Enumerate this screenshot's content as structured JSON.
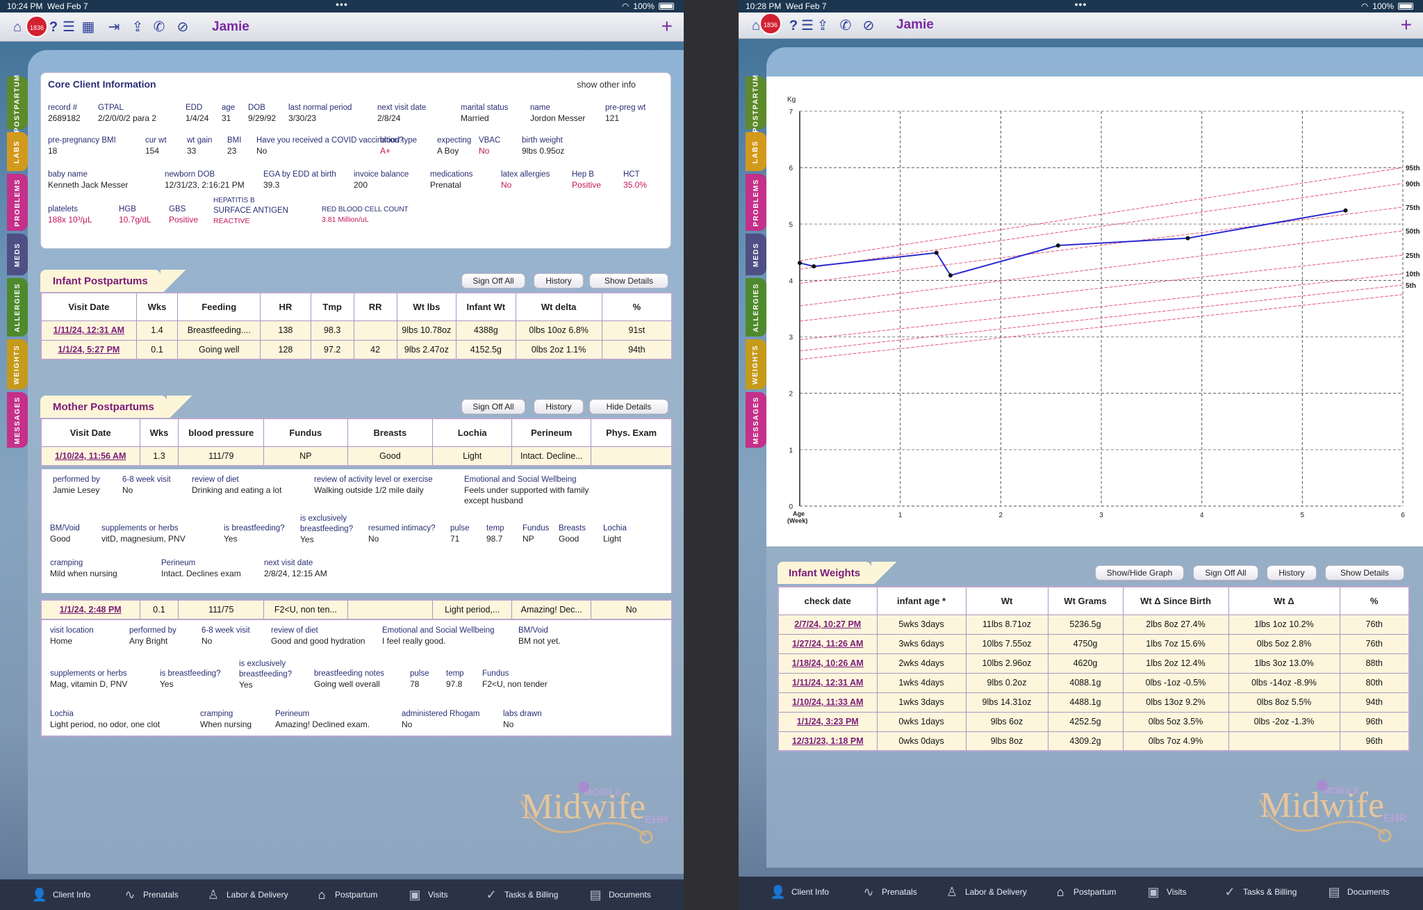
{
  "left": {
    "status": {
      "time": "10:24 PM",
      "date": "Wed Feb 7",
      "battery": "100%"
    },
    "topbar": {
      "badge": "1836",
      "patient": "Jamie"
    },
    "sidetabs": [
      "POSTPARTUM",
      "LABS",
      "PROBLEMS",
      "MEDS",
      "ALLERGIES",
      "WEIGHTS",
      "MESSAGES"
    ],
    "core": {
      "title": "Core Client Information",
      "other": "show other info",
      "fields": [
        {
          "l": "record #",
          "v": "2689182"
        },
        {
          "l": "GTPAL",
          "v": "2/2/0/0/2 para 2"
        },
        {
          "l": "EDD",
          "v": "1/4/24"
        },
        {
          "l": "age",
          "v": "31"
        },
        {
          "l": "DOB",
          "v": "9/29/92"
        },
        {
          "l": "last normal period",
          "v": "3/30/23"
        },
        {
          "l": "next visit date",
          "v": "2/8/24"
        },
        {
          "l": "marital status",
          "v": "Married"
        },
        {
          "l": "name",
          "v": "Jordon Messer"
        },
        {
          "l": "pre-preg wt",
          "v": "121"
        },
        {
          "l": "pre-pregnancy BMI",
          "v": "18"
        },
        {
          "l": "cur wt",
          "v": "154"
        },
        {
          "l": "wt gain",
          "v": "33"
        },
        {
          "l": "BMI",
          "v": "23"
        },
        {
          "l": "Have you received a COVID vaccination?",
          "v": "No"
        },
        {
          "l": "blood type",
          "v": "A+"
        },
        {
          "l": "expecting",
          "v": "A Boy"
        },
        {
          "l": "VBAC",
          "v": "No"
        },
        {
          "l": "birth weight",
          "v": "9lbs 0.95oz"
        },
        {
          "l": "baby name",
          "v": "Kenneth Jack Messer"
        },
        {
          "l": "newborn DOB",
          "v": "12/31/23, 2:16:21 PM"
        },
        {
          "l": "EGA by EDD at birth",
          "v": "39.3"
        },
        {
          "l": "invoice balance",
          "v": "200"
        },
        {
          "l": "medications",
          "v": "Prenatal"
        },
        {
          "l": "latex allergies",
          "v": "No"
        },
        {
          "l": "Hep B",
          "v": "Positive"
        },
        {
          "l": "HCT",
          "v": "35.0%"
        },
        {
          "l": "platelets",
          "v": "188x 10³/μL"
        },
        {
          "l": "HGB",
          "v": "10.7g/dL"
        },
        {
          "l": "GBS",
          "v": "Positive"
        },
        {
          "l": "HEPATITIS B",
          "l2": "SURFACE ANTIGEN",
          "v": "REACTIVE"
        },
        {
          "l": "RED BLOOD CELL COUNT",
          "v": "3.81 Million/uL"
        }
      ]
    },
    "infant_pp": {
      "title": "Infant Postpartums",
      "buttons": [
        "Sign Off All",
        "History",
        "Show Details"
      ],
      "headers": [
        "Visit Date",
        "Wks",
        "Feeding",
        "HR",
        "Tmp",
        "RR",
        "Wt lbs",
        "Infant Wt",
        "Wt delta",
        "%"
      ],
      "rows": [
        [
          "1/11/24, 12:31 AM",
          "1.4",
          "Breastfeeding....",
          "138",
          "98.3",
          "",
          "9lbs 10.78oz",
          "4388g",
          "0lbs 10oz 6.8%",
          "91st"
        ],
        [
          "1/1/24, 5:27 PM",
          "0.1",
          "Going well",
          "128",
          "97.2",
          "42",
          "9lbs 2.47oz",
          "4152.5g",
          "0lbs 2oz 1.1%",
          "94th"
        ]
      ]
    },
    "mother_pp": {
      "title": "Mother Postpartums",
      "buttons": [
        "Sign Off All",
        "History",
        "Hide Details"
      ],
      "headers": [
        "Visit Date",
        "Wks",
        "blood pressure",
        "Fundus",
        "Breasts",
        "Lochia",
        "Perineum",
        "Phys. Exam"
      ],
      "row1": [
        "1/10/24, 11:56 AM",
        "1.3",
        "111/79",
        "NP",
        "Good",
        "Light",
        "Intact. Decline...",
        ""
      ],
      "detail1": [
        {
          "l": "performed by",
          "v": "Jamie Lesey"
        },
        {
          "l": "6-8 week visit",
          "v": "No"
        },
        {
          "l": "review of diet",
          "v": "Drinking  and eating a lot"
        },
        {
          "l": "review of activity level or exercise",
          "v": "Walking outside 1/2 mile daily"
        },
        {
          "l": "Emotional and Social Wellbeing",
          "v": "Feels under supported with family"
        },
        {
          "l": "",
          "v": "except husband"
        },
        {
          "l": "BM/Void",
          "v": "Good"
        },
        {
          "l": "supplements or herbs",
          "v": "vitD, magnesium, PNV"
        },
        {
          "l": "is breastfeeding?",
          "v": "Yes"
        },
        {
          "l": "is exclusively",
          "l2": "breastfeeding?",
          "v": "Yes"
        },
        {
          "l": "resumed intimacy?",
          "v": "No"
        },
        {
          "l": "pulse",
          "v": "71"
        },
        {
          "l": "temp",
          "v": "98.7"
        },
        {
          "l": "Fundus",
          "v": "NP"
        },
        {
          "l": "Breasts",
          "v": "Good"
        },
        {
          "l": "Lochia",
          "v": "Light"
        },
        {
          "l": "cramping",
          "v": "Mild when nursing"
        },
        {
          "l": "Perineum",
          "v": "Intact. Declines exam"
        },
        {
          "l": "next visit date",
          "v": "2/8/24, 12:15 AM"
        }
      ],
      "row2": [
        "1/1/24, 2:48 PM",
        "0.1",
        "111/75",
        "F2<U, non ten...",
        "",
        "Light period,...",
        "Amazing! Dec...",
        "No"
      ],
      "detail2": [
        {
          "l": "visit location",
          "v": "Home"
        },
        {
          "l": "performed by",
          "v": "Any Bright"
        },
        {
          "l": "6-8 week visit",
          "v": "No"
        },
        {
          "l": "review of diet",
          "v": "Good and good hydration"
        },
        {
          "l": "Emotional and Social Wellbeing",
          "v": "I feel really good."
        },
        {
          "l": "BM/Void",
          "v": "BM not yet."
        },
        {
          "l": "supplements or herbs",
          "v": "Mag, vitamin D, PNV"
        },
        {
          "l": "is breastfeeding?",
          "v": "Yes"
        },
        {
          "l": "is exclusively",
          "l2": "breastfeeding?",
          "v": "Yes"
        },
        {
          "l": "breastfeeding notes",
          "v": "Going well overall"
        },
        {
          "l": "pulse",
          "v": "78"
        },
        {
          "l": "temp",
          "v": "97.8"
        },
        {
          "l": "Fundus",
          "v": "F2<U, non tender"
        },
        {
          "l": "Lochia",
          "v": "Light period, no odor, one clot"
        },
        {
          "l": "cramping",
          "v": "When nursing"
        },
        {
          "l": "Perineum",
          "v": "Amazing! Declined exam."
        },
        {
          "l": "administered Rhogam",
          "v": "No"
        },
        {
          "l": "labs drawn",
          "v": "No"
        }
      ]
    },
    "logo": {
      "main": "Midwife",
      "mobile": "MOBILE",
      "ehr": "EHR"
    },
    "bottombar": [
      "Client Info",
      "Prenatals",
      "Labor & Delivery",
      "Postpartum",
      "Visits",
      "Tasks & Billing",
      "Documents"
    ]
  },
  "right": {
    "status": {
      "time": "10:28 PM",
      "date": "Wed Feb 7",
      "battery": "100%"
    },
    "topbar": {
      "badge": "1836",
      "patient": "Jamie"
    },
    "infant_weights": {
      "title": "Infant Weights",
      "buttons": [
        "Show/Hide Graph",
        "Sign Off All",
        "History",
        "Show Details"
      ],
      "headers": [
        "check date",
        "infant age *",
        "Wt",
        "Wt Grams",
        "Wt Δ Since Birth",
        "Wt Δ",
        "%"
      ],
      "rows": [
        [
          "2/7/24, 10:27 PM",
          "5wks 3days",
          "11lbs 8.71oz",
          "5236.5g",
          "2lbs 8oz 27.4%",
          "1lbs 1oz 10.2%",
          "76th"
        ],
        [
          "1/27/24, 11:26 AM",
          "3wks 6days",
          "10lbs 7.55oz",
          "4750g",
          "1lbs 7oz 15.6%",
          "0lbs 5oz 2.8%",
          "76th"
        ],
        [
          "1/18/24, 10:26 AM",
          "2wks 4days",
          "10lbs 2.96oz",
          "4620g",
          "1lbs 2oz 12.4%",
          "1lbs 3oz 13.0%",
          "88th"
        ],
        [
          "1/11/24, 12:31 AM",
          "1wks 4days",
          "9lbs 0.2oz",
          "4088.1g",
          "0lbs -1oz -0.5%",
          "0lbs -14oz -8.9%",
          "80th"
        ],
        [
          "1/10/24, 11:33 AM",
          "1wks 3days",
          "9lbs 14.31oz",
          "4488.1g",
          "0lbs 13oz 9.2%",
          "0lbs 8oz 5.5%",
          "94th"
        ],
        [
          "1/1/24, 3:23 PM",
          "0wks 1days",
          "9lbs 6oz",
          "4252.5g",
          "0lbs 5oz 3.5%",
          "0lbs -2oz -1.3%",
          "96th"
        ],
        [
          "12/31/23, 1:18 PM",
          "0wks 0days",
          "9lbs 8oz",
          "4309.2g",
          "0lbs 7oz 4.9%",
          "",
          "96th"
        ]
      ]
    },
    "chart_data": {
      "type": "line",
      "ylabel": "Kg",
      "xlabel": "Age (Week)",
      "xlim": [
        0,
        6
      ],
      "ylim": [
        0,
        7
      ],
      "xticks": [
        1,
        2,
        3,
        4,
        5,
        6
      ],
      "yticks": [
        0,
        1,
        2,
        3,
        4,
        5,
        6,
        7
      ],
      "series": [
        {
          "x": [
            0,
            0.14,
            1.36,
            1.5,
            2.57,
            3.86,
            5.43
          ],
          "y": [
            4.31,
            4.25,
            4.49,
            4.09,
            4.62,
            4.75,
            5.24
          ],
          "color": "#2b2bd0"
        }
      ],
      "percentiles": [
        {
          "name": "95th",
          "start": 4.35,
          "end": 6.0
        },
        {
          "name": "90th",
          "start": 4.2,
          "end": 5.72
        },
        {
          "name": "75th",
          "start": 3.95,
          "end": 5.3
        },
        {
          "name": "50th",
          "start": 3.55,
          "end": 4.88
        },
        {
          "name": "25th",
          "start": 3.28,
          "end": 4.45
        },
        {
          "name": "10th",
          "start": 2.95,
          "end": 4.12
        },
        {
          "name": "5th",
          "start": 2.75,
          "end": 3.92
        },
        {
          "name": "",
          "start": 2.6,
          "end": 3.75
        }
      ]
    }
  }
}
